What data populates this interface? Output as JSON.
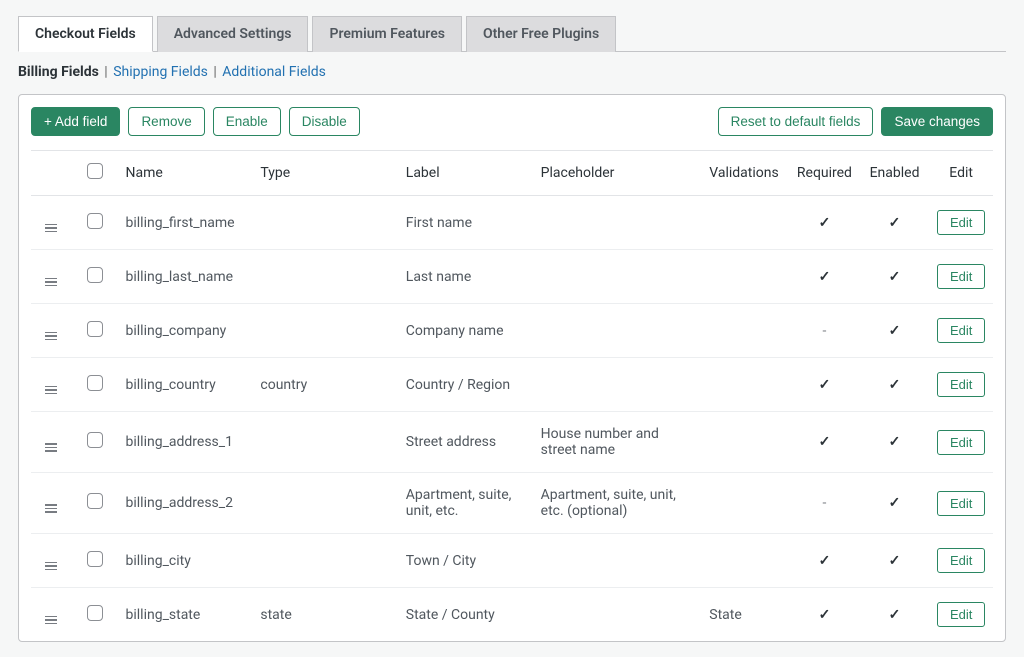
{
  "tabs": [
    {
      "id": "checkout",
      "label": "Checkout Fields",
      "active": true
    },
    {
      "id": "advanced",
      "label": "Advanced Settings",
      "active": false
    },
    {
      "id": "premium",
      "label": "Premium Features",
      "active": false
    },
    {
      "id": "plugins",
      "label": "Other Free Plugins",
      "active": false
    }
  ],
  "subnav": {
    "billing": "Billing Fields",
    "shipping": "Shipping Fields",
    "additional": "Additional Fields"
  },
  "toolbar": {
    "add": "+ Add field",
    "remove": "Remove",
    "enable": "Enable",
    "disable": "Disable",
    "reset": "Reset to default fields",
    "save": "Save changes"
  },
  "columns": {
    "name": "Name",
    "type": "Type",
    "label": "Label",
    "placeholder": "Placeholder",
    "validations": "Validations",
    "required": "Required",
    "enabled": "Enabled",
    "edit": "Edit"
  },
  "rows": [
    {
      "name": "billing_first_name",
      "type": "",
      "label": "First name",
      "placeholder": "",
      "validations": "",
      "required": true,
      "enabled": true
    },
    {
      "name": "billing_last_name",
      "type": "",
      "label": "Last name",
      "placeholder": "",
      "validations": "",
      "required": true,
      "enabled": true
    },
    {
      "name": "billing_company",
      "type": "",
      "label": "Company name",
      "placeholder": "",
      "validations": "",
      "required": false,
      "enabled": true
    },
    {
      "name": "billing_country",
      "type": "country",
      "label": "Country / Region",
      "placeholder": "",
      "validations": "",
      "required": true,
      "enabled": true
    },
    {
      "name": "billing_address_1",
      "type": "",
      "label": "Street address",
      "placeholder": "House number and street name",
      "validations": "",
      "required": true,
      "enabled": true
    },
    {
      "name": "billing_address_2",
      "type": "",
      "label": "Apartment, suite, unit, etc.",
      "placeholder": "Apartment, suite, unit, etc. (optional)",
      "validations": "",
      "required": false,
      "enabled": true
    },
    {
      "name": "billing_city",
      "type": "",
      "label": "Town / City",
      "placeholder": "",
      "validations": "",
      "required": true,
      "enabled": true
    },
    {
      "name": "billing_state",
      "type": "state",
      "label": "State / County",
      "placeholder": "",
      "validations": "State",
      "required": true,
      "enabled": true
    }
  ],
  "edit_label": "Edit"
}
